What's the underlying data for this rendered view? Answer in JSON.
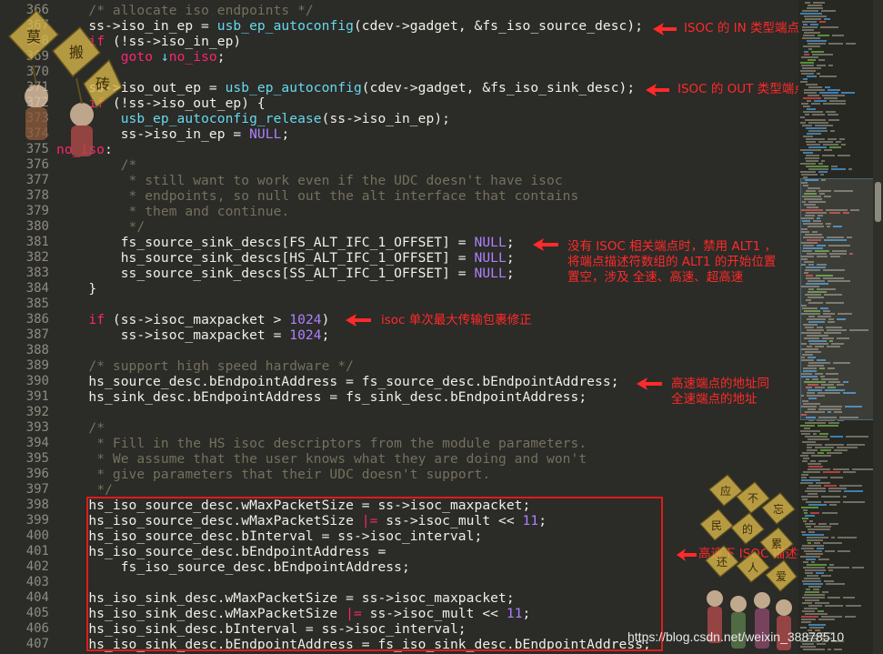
{
  "lines": [
    {
      "n": "366",
      "segs": [
        {
          "t": "    ",
          "c": ""
        },
        {
          "t": "/* allocate iso endpoints */",
          "c": "cm"
        }
      ]
    },
    {
      "n": "367",
      "segs": [
        {
          "t": "    ss->iso_in_ep = ",
          "c": ""
        },
        {
          "t": "usb_ep_autoconfig",
          "c": "fn"
        },
        {
          "t": "(cdev->gadget, &fs_iso_source_desc);",
          "c": ""
        }
      ]
    },
    {
      "n": "368",
      "segs": [
        {
          "t": "    ",
          "c": ""
        },
        {
          "t": "if",
          "c": "kw"
        },
        {
          "t": " (!ss->iso_in_ep)",
          "c": ""
        }
      ]
    },
    {
      "n": "369",
      "segs": [
        {
          "t": "        ",
          "c": ""
        },
        {
          "t": "goto",
          "c": "kw"
        },
        {
          "t": " ",
          "c": ""
        },
        {
          "t": "↓",
          "c": "fn"
        },
        {
          "t": "no_iso",
          "c": "kw"
        },
        {
          "t": ";",
          "c": ""
        }
      ]
    },
    {
      "n": "370",
      "segs": []
    },
    {
      "n": "371",
      "segs": [
        {
          "t": "    ss->iso_out_ep = ",
          "c": ""
        },
        {
          "t": "usb_ep_autoconfig",
          "c": "fn"
        },
        {
          "t": "(cdev->gadget, &fs_iso_sink_desc);",
          "c": ""
        }
      ]
    },
    {
      "n": "372",
      "segs": [
        {
          "t": "    ",
          "c": ""
        },
        {
          "t": "if",
          "c": "kw"
        },
        {
          "t": " (!ss->iso_out_ep) {",
          "c": ""
        }
      ]
    },
    {
      "n": "373",
      "segs": [
        {
          "t": "        ",
          "c": ""
        },
        {
          "t": "usb_ep_autoconfig_release",
          "c": "fn"
        },
        {
          "t": "(ss->iso_in_ep);",
          "c": ""
        }
      ]
    },
    {
      "n": "374",
      "segs": [
        {
          "t": "        ss->iso_in_ep = ",
          "c": ""
        },
        {
          "t": "NULL",
          "c": "num"
        },
        {
          "t": ";",
          "c": ""
        }
      ]
    },
    {
      "n": "375",
      "segs": [
        {
          "t": "no_iso",
          "c": "kw"
        },
        {
          "t": ":",
          "c": ""
        }
      ]
    },
    {
      "n": "376",
      "segs": [
        {
          "t": "        ",
          "c": ""
        },
        {
          "t": "/*",
          "c": "cm"
        }
      ]
    },
    {
      "n": "377",
      "segs": [
        {
          "t": "         ",
          "c": ""
        },
        {
          "t": "* still want to work even if the UDC doesn't have isoc",
          "c": "cm"
        }
      ]
    },
    {
      "n": "378",
      "segs": [
        {
          "t": "         ",
          "c": ""
        },
        {
          "t": "* endpoints, so null out the alt interface that contains",
          "c": "cm"
        }
      ]
    },
    {
      "n": "379",
      "segs": [
        {
          "t": "         ",
          "c": ""
        },
        {
          "t": "* them and continue.",
          "c": "cm"
        }
      ]
    },
    {
      "n": "380",
      "segs": [
        {
          "t": "         ",
          "c": ""
        },
        {
          "t": "*/",
          "c": "cm"
        }
      ]
    },
    {
      "n": "381",
      "segs": [
        {
          "t": "        fs_source_sink_descs[FS_ALT_IFC_1_OFFSET] = ",
          "c": ""
        },
        {
          "t": "NULL",
          "c": "num"
        },
        {
          "t": ";",
          "c": ""
        }
      ]
    },
    {
      "n": "382",
      "segs": [
        {
          "t": "        hs_source_sink_descs[HS_ALT_IFC_1_OFFSET] = ",
          "c": ""
        },
        {
          "t": "NULL",
          "c": "num"
        },
        {
          "t": ";",
          "c": ""
        }
      ]
    },
    {
      "n": "383",
      "segs": [
        {
          "t": "        ss_source_sink_descs[SS_ALT_IFC_1_OFFSET] = ",
          "c": ""
        },
        {
          "t": "NULL",
          "c": "num"
        },
        {
          "t": ";",
          "c": ""
        }
      ]
    },
    {
      "n": "384",
      "segs": [
        {
          "t": "    }",
          "c": ""
        }
      ]
    },
    {
      "n": "385",
      "segs": []
    },
    {
      "n": "386",
      "segs": [
        {
          "t": "    ",
          "c": ""
        },
        {
          "t": "if",
          "c": "kw"
        },
        {
          "t": " (ss->isoc_maxpacket > ",
          "c": ""
        },
        {
          "t": "1024",
          "c": "num"
        },
        {
          "t": ")",
          "c": ""
        }
      ]
    },
    {
      "n": "387",
      "segs": [
        {
          "t": "        ss->isoc_maxpacket = ",
          "c": ""
        },
        {
          "t": "1024",
          "c": "num"
        },
        {
          "t": ";",
          "c": ""
        }
      ]
    },
    {
      "n": "388",
      "segs": []
    },
    {
      "n": "389",
      "segs": [
        {
          "t": "    ",
          "c": ""
        },
        {
          "t": "/* support high speed hardware */",
          "c": "cm"
        }
      ]
    },
    {
      "n": "390",
      "segs": [
        {
          "t": "    hs_source_desc.bEndpointAddress = fs_source_desc.bEndpointAddress;",
          "c": ""
        }
      ]
    },
    {
      "n": "391",
      "segs": [
        {
          "t": "    hs_sink_desc.bEndpointAddress = fs_sink_desc.bEndpointAddress;",
          "c": ""
        }
      ]
    },
    {
      "n": "392",
      "segs": []
    },
    {
      "n": "393",
      "segs": [
        {
          "t": "    ",
          "c": ""
        },
        {
          "t": "/*",
          "c": "cm"
        }
      ]
    },
    {
      "n": "394",
      "segs": [
        {
          "t": "     ",
          "c": ""
        },
        {
          "t": "* Fill in the HS isoc descriptors from the module parameters.",
          "c": "cm"
        }
      ]
    },
    {
      "n": "395",
      "segs": [
        {
          "t": "     ",
          "c": ""
        },
        {
          "t": "* We assume that the user knows what they are doing and won't",
          "c": "cm"
        }
      ]
    },
    {
      "n": "396",
      "segs": [
        {
          "t": "     ",
          "c": ""
        },
        {
          "t": "* give parameters that their UDC doesn't support.",
          "c": "cm"
        }
      ]
    },
    {
      "n": "397",
      "segs": [
        {
          "t": "     ",
          "c": ""
        },
        {
          "t": "*/",
          "c": "cm"
        }
      ]
    },
    {
      "n": "398",
      "segs": [
        {
          "t": "    hs_iso_source_desc.wMaxPacketSize = ss->isoc_maxpacket;",
          "c": ""
        }
      ]
    },
    {
      "n": "399",
      "segs": [
        {
          "t": "    hs_iso_source_desc.wMaxPacketSize ",
          "c": ""
        },
        {
          "t": "|=",
          "c": "kw"
        },
        {
          "t": " ss->isoc_mult << ",
          "c": ""
        },
        {
          "t": "11",
          "c": "num"
        },
        {
          "t": ";",
          "c": ""
        }
      ]
    },
    {
      "n": "400",
      "segs": [
        {
          "t": "    hs_iso_source_desc.bInterval = ss->isoc_interval;",
          "c": ""
        }
      ]
    },
    {
      "n": "401",
      "segs": [
        {
          "t": "    hs_iso_source_desc.bEndpointAddress =",
          "c": ""
        }
      ]
    },
    {
      "n": "402",
      "segs": [
        {
          "t": "        fs_iso_source_desc.bEndpointAddress;",
          "c": ""
        }
      ]
    },
    {
      "n": "403",
      "segs": []
    },
    {
      "n": "404",
      "segs": [
        {
          "t": "    hs_iso_sink_desc.wMaxPacketSize = ss->isoc_maxpacket;",
          "c": ""
        }
      ]
    },
    {
      "n": "405",
      "segs": [
        {
          "t": "    hs_iso_sink_desc.wMaxPacketSize ",
          "c": ""
        },
        {
          "t": "|=",
          "c": "kw"
        },
        {
          "t": " ss->isoc_mult << ",
          "c": ""
        },
        {
          "t": "11",
          "c": "num"
        },
        {
          "t": ";",
          "c": ""
        }
      ]
    },
    {
      "n": "406",
      "segs": [
        {
          "t": "    hs_iso_sink_desc.bInterval = ss->isoc_interval;",
          "c": ""
        }
      ]
    },
    {
      "n": "407",
      "segs": [
        {
          "t": "    hs_iso_sink_desc.bEndpointAddress = fs_iso_sink_desc.bEndpointAddress;",
          "c": ""
        }
      ]
    }
  ],
  "annotations": {
    "in_ep": "ISOC 的 IN 类型端点",
    "out_ep": "ISOC 的 OUT 类型端点",
    "no_iso_line1": "没有 ISOC 相关端点时，禁用 ALT1 ，",
    "no_iso_line2": "将端点描述符数组的 ALT1 的开始位置",
    "no_iso_line3": "置空，涉及 全速、高速、超高速",
    "maxpacket": "isoc 单次最大传输包裹修正",
    "hs_addr_line1": "高速端点的地址同",
    "hs_addr_line2": "全速端点的地址",
    "hs_iso_fill": "高速下 ISOC 描述符填充"
  },
  "stickers": {
    "left": [
      "莫",
      "搬",
      "砖"
    ],
    "right": [
      "应",
      "不",
      "忘",
      "民",
      "的",
      "累",
      "还",
      "人",
      "爱"
    ]
  },
  "watermark": "https://blog.csdn.net/weixin_38878510",
  "colors": {
    "annotation": "#ff2a2a",
    "highlight_box": "#e01b1b"
  }
}
